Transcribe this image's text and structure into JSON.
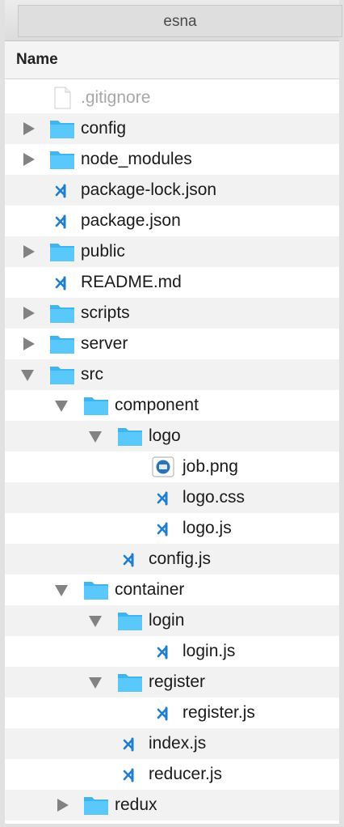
{
  "window": {
    "title": "esna"
  },
  "header": {
    "name_column": "Name"
  },
  "colors": {
    "folder": "#5ac8fa",
    "folder_dark": "#3fb4ee",
    "vscode": "#1e7fd1",
    "hidden_text": "#a8a8a8",
    "triangle": "#828282"
  },
  "rows": [
    {
      "name": ".gitignore",
      "depth": 0,
      "kind": "blank-file",
      "disclosure": "none",
      "hidden": true
    },
    {
      "name": "config",
      "depth": 0,
      "kind": "folder",
      "disclosure": "collapsed"
    },
    {
      "name": "node_modules",
      "depth": 0,
      "kind": "folder",
      "disclosure": "collapsed"
    },
    {
      "name": "package-lock.json",
      "depth": 0,
      "kind": "vscode-file",
      "disclosure": "none"
    },
    {
      "name": "package.json",
      "depth": 0,
      "kind": "vscode-file",
      "disclosure": "none"
    },
    {
      "name": "public",
      "depth": 0,
      "kind": "folder",
      "disclosure": "collapsed"
    },
    {
      "name": "README.md",
      "depth": 0,
      "kind": "vscode-file",
      "disclosure": "none"
    },
    {
      "name": "scripts",
      "depth": 0,
      "kind": "folder",
      "disclosure": "collapsed"
    },
    {
      "name": "server",
      "depth": 0,
      "kind": "folder",
      "disclosure": "collapsed"
    },
    {
      "name": "src",
      "depth": 0,
      "kind": "folder",
      "disclosure": "expanded"
    },
    {
      "name": "component",
      "depth": 1,
      "kind": "folder",
      "disclosure": "expanded"
    },
    {
      "name": "logo",
      "depth": 2,
      "kind": "folder",
      "disclosure": "expanded"
    },
    {
      "name": "job.png",
      "depth": 3,
      "kind": "image-file",
      "disclosure": "none"
    },
    {
      "name": "logo.css",
      "depth": 3,
      "kind": "vscode-file",
      "disclosure": "none"
    },
    {
      "name": "logo.js",
      "depth": 3,
      "kind": "vscode-file",
      "disclosure": "none"
    },
    {
      "name": "config.js",
      "depth": 2,
      "kind": "vscode-file",
      "disclosure": "none"
    },
    {
      "name": "container",
      "depth": 1,
      "kind": "folder",
      "disclosure": "expanded"
    },
    {
      "name": "login",
      "depth": 2,
      "kind": "folder",
      "disclosure": "expanded"
    },
    {
      "name": "login.js",
      "depth": 3,
      "kind": "vscode-file",
      "disclosure": "none"
    },
    {
      "name": "register",
      "depth": 2,
      "kind": "folder",
      "disclosure": "expanded"
    },
    {
      "name": "register.js",
      "depth": 3,
      "kind": "vscode-file",
      "disclosure": "none"
    },
    {
      "name": "index.js",
      "depth": 2,
      "kind": "vscode-file",
      "disclosure": "none"
    },
    {
      "name": "reducer.js",
      "depth": 2,
      "kind": "vscode-file",
      "disclosure": "none"
    },
    {
      "name": "redux",
      "depth": 1,
      "kind": "folder",
      "disclosure": "collapsed"
    }
  ]
}
